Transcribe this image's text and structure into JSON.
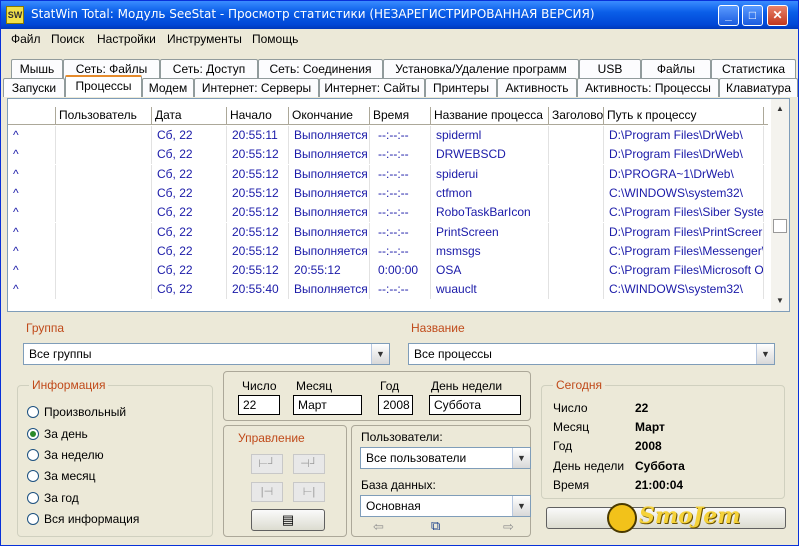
{
  "window": {
    "title": "StatWin Total: Модуль SeeStat - Просмотр статистики (НЕЗАРЕГИСТРИРОВАННАЯ ВЕРСИЯ)",
    "icon_text": "SW",
    "minimize": "_",
    "maximize": "□",
    "close": "✕"
  },
  "menu": [
    "Файл",
    "Поиск",
    "Настройки",
    "Инструменты",
    "Помощь"
  ],
  "tabs_top": [
    "Мышь",
    "Сеть: Файлы",
    "Сеть: Доступ",
    "Сеть: Соединения",
    "Установка/Удаление программ",
    "USB",
    "Файлы",
    "Статистика"
  ],
  "tabs_bottom": [
    "Запуски",
    "Процессы",
    "Модем",
    "Интернет: Серверы",
    "Интернет: Сайты",
    "Принтеры",
    "Активность",
    "Активность: Процессы",
    "Клавиатура"
  ],
  "active_tab": "Процессы",
  "table": {
    "columns": [
      "Пользователь",
      "Дата",
      "Начало",
      "Окончание",
      "Время",
      "Название процесса",
      "Заголово",
      "Путь к процессу"
    ],
    "rows": [
      [
        "^",
        "",
        "Сб, 22",
        "20:55:11",
        "Выполняется",
        "--:--:--",
        "spiderml",
        "",
        "D:\\Program Files\\DrWeb\\"
      ],
      [
        "^",
        "",
        "Сб, 22",
        "20:55:12",
        "Выполняется",
        "--:--:--",
        "DRWEBSCD",
        "",
        "D:\\Program Files\\DrWeb\\"
      ],
      [
        "^",
        "",
        "Сб, 22",
        "20:55:12",
        "Выполняется",
        "--:--:--",
        "spiderui",
        "",
        "D:\\PROGRA~1\\DrWeb\\"
      ],
      [
        "^",
        "",
        "Сб, 22",
        "20:55:12",
        "Выполняется",
        "--:--:--",
        "ctfmon",
        "",
        "C:\\WINDOWS\\system32\\"
      ],
      [
        "^",
        "",
        "Сб, 22",
        "20:55:12",
        "Выполняется",
        "--:--:--",
        "RoboTaskBarIcon",
        "",
        "C:\\Program Files\\Siber Syste"
      ],
      [
        "^",
        "",
        "Сб, 22",
        "20:55:12",
        "Выполняется",
        "--:--:--",
        "PrintScreen",
        "",
        "D:\\Program Files\\PrintScreer"
      ],
      [
        "^",
        "",
        "Сб, 22",
        "20:55:12",
        "Выполняется",
        "--:--:--",
        "msmsgs",
        "",
        "C:\\Program Files\\Messenger\\"
      ],
      [
        "^",
        "",
        "Сб, 22",
        "20:55:12",
        "20:55:12",
        "0:00:00",
        "OSA",
        "",
        "C:\\Program Files\\Microsoft O"
      ],
      [
        "^",
        "",
        "Сб, 22",
        "20:55:40",
        "Выполняется",
        "--:--:--",
        "wuauclt",
        "",
        "C:\\WINDOWS\\system32\\"
      ]
    ]
  },
  "group": {
    "label": "Группа",
    "value": "Все группы"
  },
  "name": {
    "label": "Название",
    "value": "Все процессы"
  },
  "info": {
    "label": "Информация",
    "options": [
      "Произвольный",
      "За день",
      "За неделю",
      "За месяц",
      "За год",
      "Вся информация"
    ],
    "selected": "За день"
  },
  "date": {
    "number_label": "Число",
    "number": "22",
    "month_label": "Месяц",
    "month": "Март",
    "year_label": "Год",
    "year": "2008",
    "weekday_label": "День недели",
    "weekday": "Суббота"
  },
  "control": {
    "label": "Управление",
    "btn1": "⊢┘",
    "btn2": "⊣┘",
    "btn3": "|⊣",
    "btn4": "⊢|",
    "book": "▤"
  },
  "users": {
    "label": "Пользователи:",
    "value": "Все пользователи"
  },
  "db": {
    "label": "База данных:",
    "value": "Основная",
    "prev": "⇦",
    "db_icon": "⧉",
    "next": "⇨"
  },
  "today": {
    "label": "Сегодня",
    "number_key": "Число",
    "number": "22",
    "month_key": "Месяц",
    "month": "Март",
    "year_key": "Год",
    "year": "2008",
    "weekday_key": "День недели",
    "weekday": "Суббота",
    "time_key": "Время",
    "time": "21:00:04"
  },
  "bottom_button": "",
  "watermark": "SmoJem"
}
